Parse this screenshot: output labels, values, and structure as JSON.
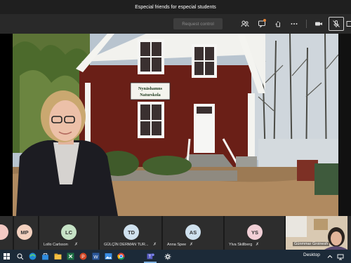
{
  "window": {
    "title": "Especial friends for especial students"
  },
  "toolbar": {
    "request_control_label": "Request control",
    "icons": [
      "participants-icon",
      "chat-icon",
      "raise-hand-icon",
      "more-icon",
      "camera-icon",
      "mic-off-icon",
      "share-tray-icon"
    ]
  },
  "video": {
    "sign_line1": "Nynäshamns",
    "sign_line2": "Naturskola"
  },
  "participants": [
    {
      "initials": "",
      "name": "",
      "color": "#f3c9c3"
    },
    {
      "initials": "MP",
      "name": "",
      "color": "#f3d1bf"
    },
    {
      "initials": "LC",
      "name": "Lollo Carlsson",
      "color": "#c6e2c6"
    },
    {
      "initials": "TD",
      "name": "GÜLÇİN DERMAN TUR...",
      "color": "#cfe1ee"
    },
    {
      "initials": "AS",
      "name": "Anna Spee",
      "color": "#cfe1ee"
    },
    {
      "initials": "YS",
      "name": "Ylva Skillberg",
      "color": "#f1cfd6"
    }
  ],
  "self_view": {
    "name": "Günmmar Groinesh"
  },
  "taskbar": {
    "desktop_label": "Desktop",
    "icons": [
      "start-icon",
      "search-icon",
      "edge-icon",
      "store-icon",
      "explorer-icon",
      "excel-icon",
      "powerpoint-icon",
      "word-icon",
      "photos-icon",
      "chrome-icon",
      "teams-icon",
      "settings-icon"
    ]
  }
}
